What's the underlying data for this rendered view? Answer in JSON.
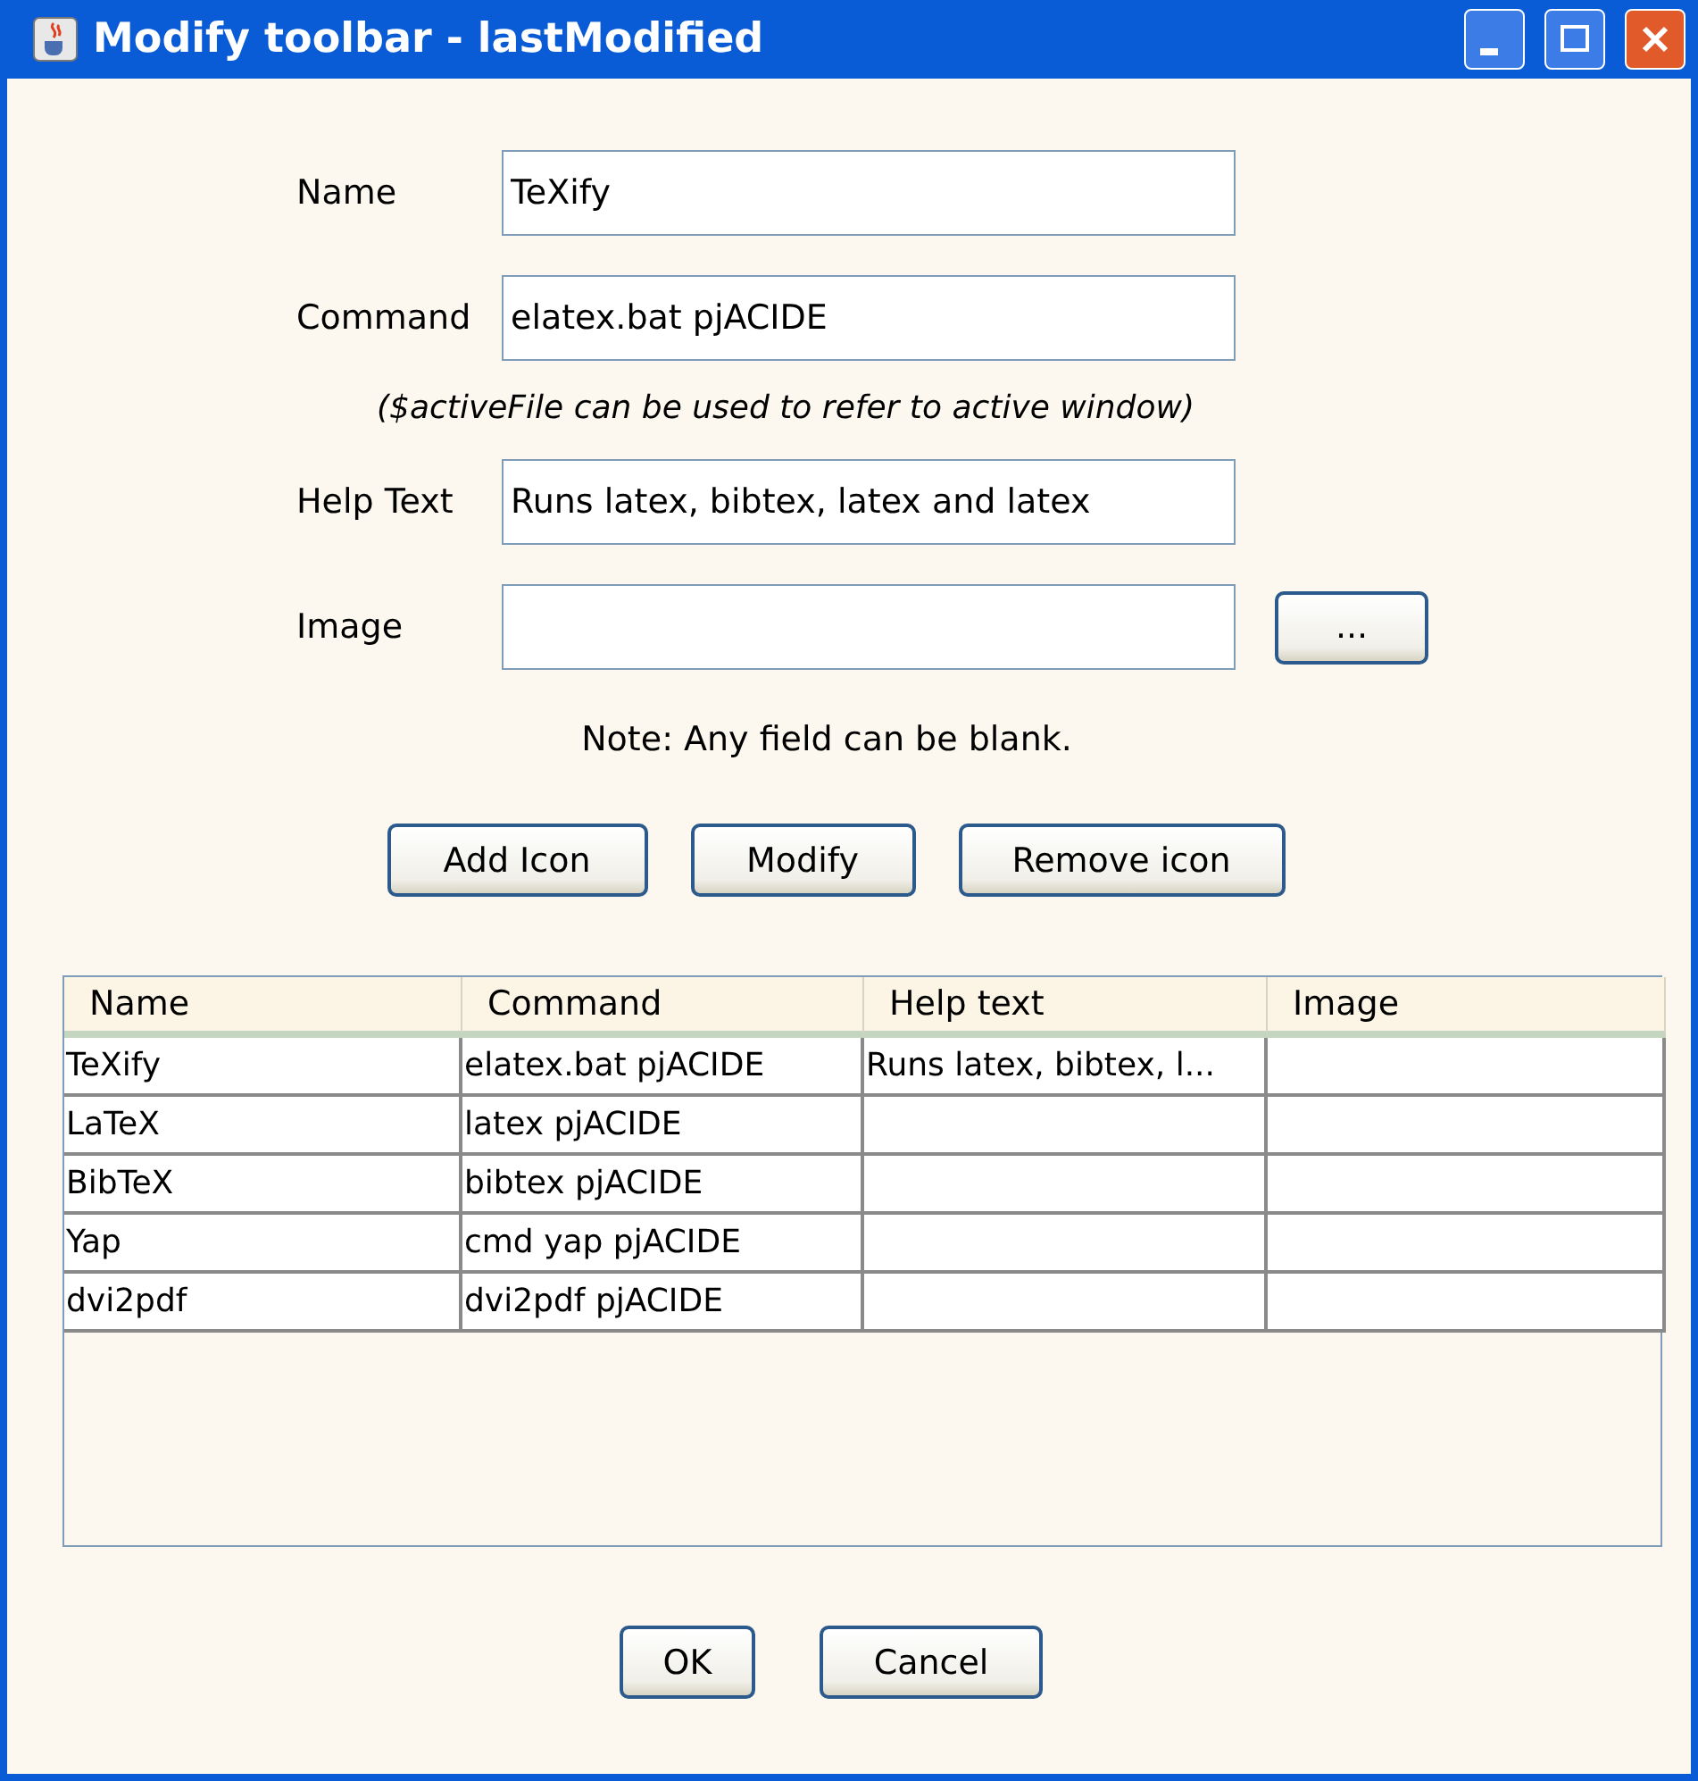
{
  "window": {
    "title": "Modify toolbar - lastModified"
  },
  "form": {
    "fields": [
      {
        "label": "Name",
        "value": "TeXify"
      },
      {
        "label": "Command",
        "value": "elatex.bat pjACIDE",
        "hint": "($activeFile can be used to refer to active window)"
      },
      {
        "label": "Help Text",
        "value": "Runs latex, bibtex, latex and latex"
      },
      {
        "label": "Image",
        "browse": "..."
      }
    ],
    "note": "Note: Any field can be blank."
  },
  "actions": [
    "Add Icon",
    "Modify",
    "Remove icon"
  ],
  "table": {
    "columns": [
      "Name",
      "Command",
      "Help text",
      "Image"
    ],
    "rows": [
      {
        "name": "TeXify",
        "command": "elatex.bat pjACIDE",
        "help_text": "Runs latex, bibtex, l..."
      },
      {
        "name": "LaTeX",
        "command": "latex pjACIDE"
      },
      {
        "name": "BibTeX",
        "command": "bibtex pjACIDE"
      },
      {
        "name": "Yap",
        "command": "cmd yap pjACIDE"
      },
      {
        "name": "dvi2pdf",
        "command": "dvi2pdf pjACIDE"
      }
    ]
  },
  "buttons": [
    "OK",
    "Cancel"
  ]
}
